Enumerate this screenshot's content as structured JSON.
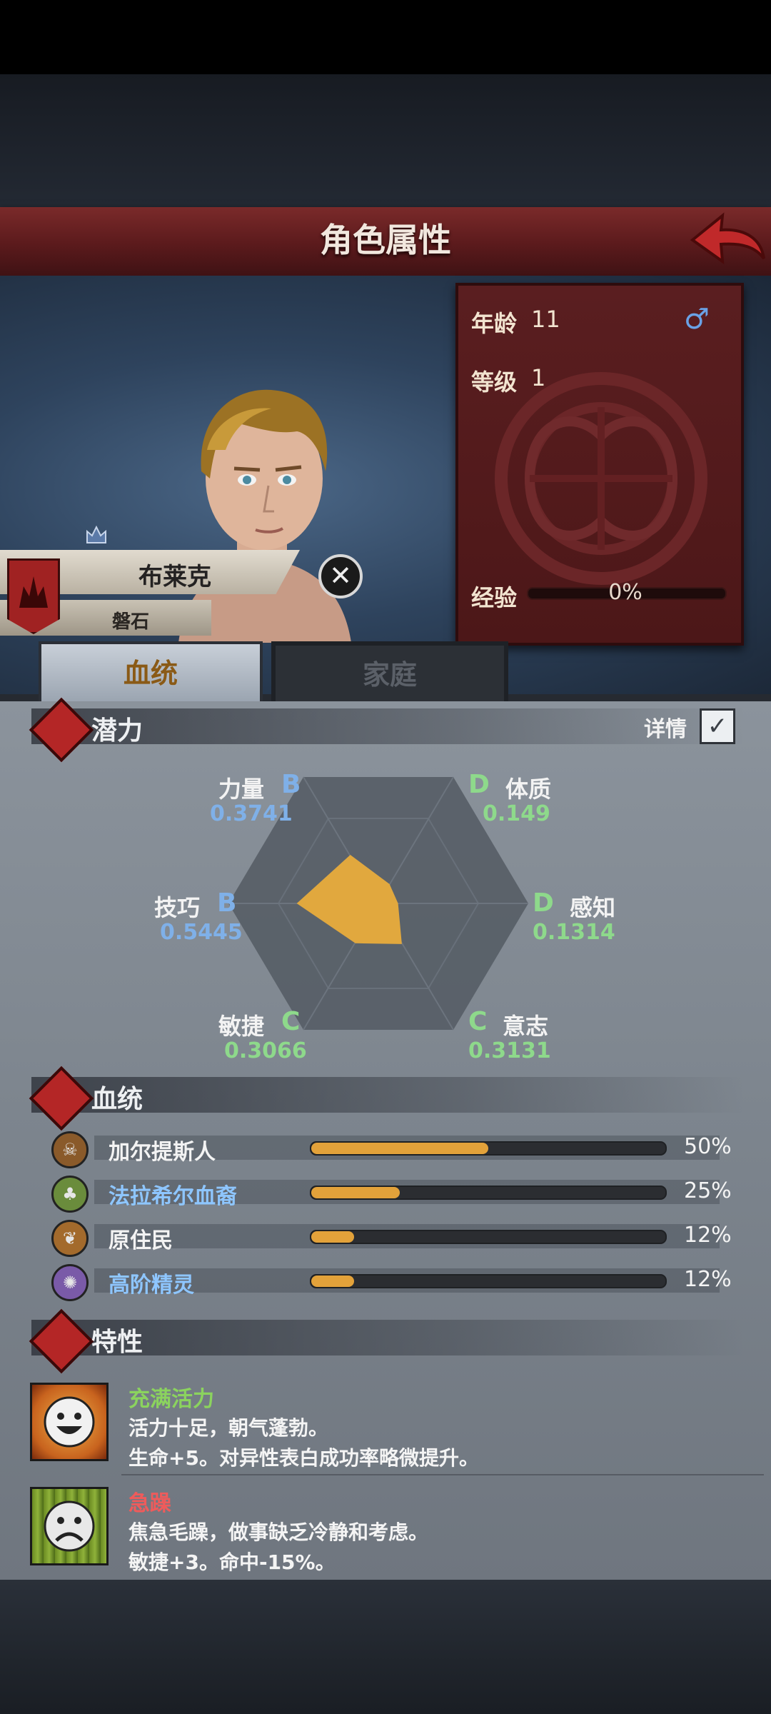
{
  "header": {
    "title": "角色属性"
  },
  "stats": {
    "age_label": "年龄",
    "age_value": "11",
    "level_label": "等级",
    "level_value": "1",
    "gender_symbol": "♂",
    "exp_label": "经验",
    "exp_value": "0%"
  },
  "character": {
    "name": "布莱克",
    "subtitle": "磐石"
  },
  "tabs": [
    {
      "label": "血统"
    },
    {
      "label": "家庭"
    }
  ],
  "potential": {
    "title": "潜力",
    "details_label": "详情",
    "details_checked": true,
    "attributes": [
      {
        "name": "力量",
        "grade": "B",
        "value": "0.3741",
        "color": "#7fb0e8"
      },
      {
        "name": "体质",
        "grade": "D",
        "value": "0.149",
        "color": "#8ed98b"
      },
      {
        "name": "感知",
        "grade": "D",
        "value": "0.1314",
        "color": "#8ed98b"
      },
      {
        "name": "意志",
        "grade": "C",
        "value": "0.3131",
        "color": "#8ed98b"
      },
      {
        "name": "敏捷",
        "grade": "C",
        "value": "0.3066",
        "color": "#8ed98b"
      },
      {
        "name": "技巧",
        "grade": "B",
        "value": "0.5445",
        "color": "#7fb0e8"
      }
    ]
  },
  "bloodline": {
    "title": "血统",
    "items": [
      {
        "name": "加尔提斯人",
        "percent": "50%",
        "fraction": 0.5,
        "name_color": "#f3f3f3",
        "icon": "horned-skull-icon",
        "icon_color": "#8a5a2a"
      },
      {
        "name": "法拉希尔血裔",
        "percent": "25%",
        "fraction": 0.25,
        "name_color": "#8ec6ff",
        "icon": "tree-icon",
        "icon_color": "#6a8c3c"
      },
      {
        "name": "原住民",
        "percent": "12%",
        "fraction": 0.12,
        "name_color": "#f3f3f3",
        "icon": "leaf-icon",
        "icon_color": "#a36a2c"
      },
      {
        "name": "高阶精灵",
        "percent": "12%",
        "fraction": 0.12,
        "name_color": "#8ec6ff",
        "icon": "arcane-rune-icon",
        "icon_color": "#7a5aa8"
      }
    ]
  },
  "traits": {
    "title": "特性",
    "items": [
      {
        "name": "充满活力",
        "name_color": "#8bd35e",
        "line1": "活力十足，朝气蓬勃。",
        "line2": "生命+5。对异性表白成功率略微提升。",
        "icon": "happy-face-icon"
      },
      {
        "name": "急躁",
        "name_color": "#ef5b5b",
        "line1": "焦急毛躁，做事缺乏冷静和考虑。",
        "line2": "敏捷+3。命中-15%。",
        "icon": "sad-face-icon"
      }
    ]
  }
}
